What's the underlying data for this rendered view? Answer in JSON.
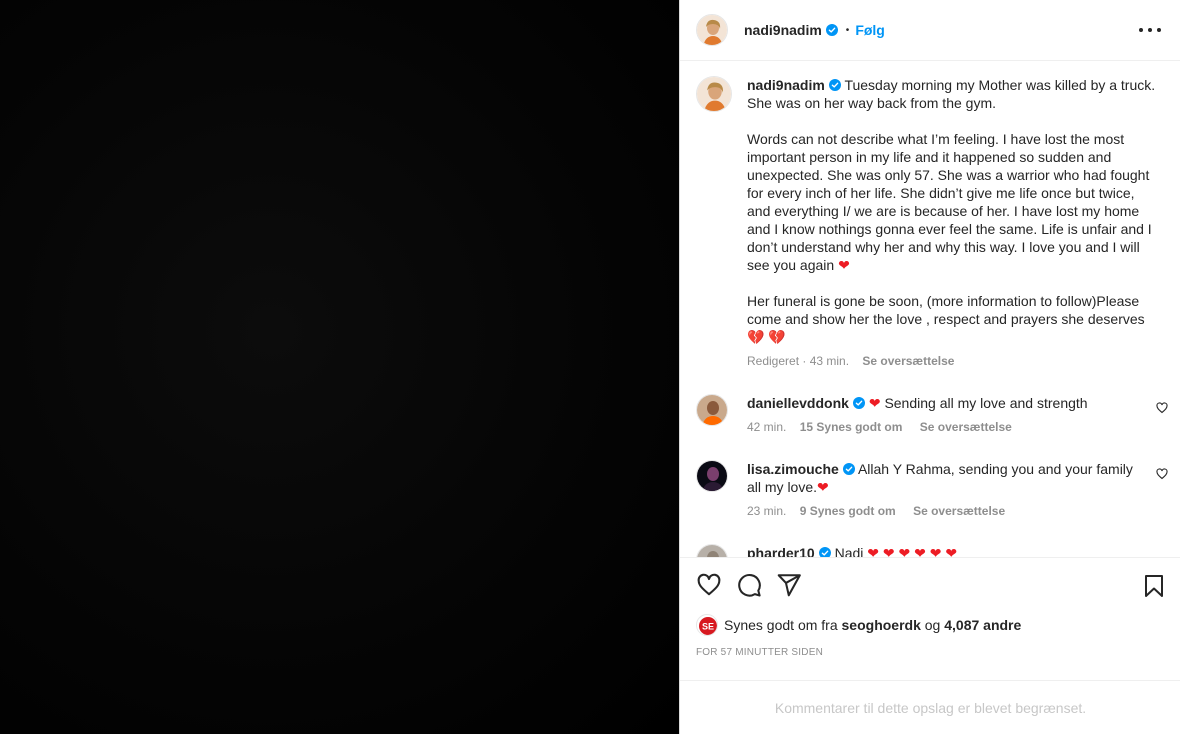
{
  "post": {
    "username": "nadi9nadim",
    "follow_label": "Følg",
    "separator": "•"
  },
  "caption": {
    "username": "nadi9nadim",
    "para1": "Tuesday morning my Mother was killed by a truck. She was on her way back from the gym.",
    "para2": "Words can not describe what I’m feeling. I have lost the most important person in my life and it happened so sudden and unexpected. She was only 57. She was a warrior who had fought for every inch of her life. She didn’t give me life once but twice, and everything I/ we are is because of her. I have lost my home and I know nothings gonna ever feel the same. Life is unfair and I don’t understand why her and why this way. I love you and I will see you again",
    "para2_emoji": "❤",
    "para3": "Her funeral is gone be soon, (more information to follow)Please come and show her the love , respect and prayers she deserves",
    "para3_emoji": "💔 💔",
    "edited": "Redigeret · 43 min.",
    "translate": "Se oversættelse"
  },
  "comments": [
    {
      "username": "daniellevddonk",
      "emoji_before": "❤",
      "text": "Sending all my love and strength",
      "time": "42 min.",
      "likes": "15 Synes godt om",
      "translate": "Se oversættelse"
    },
    {
      "username": "lisa.zimouche",
      "text": "Allah Y Rahma, sending you and your family all my love.",
      "emoji_after": "❤",
      "time": "23 min.",
      "likes": "9 Synes godt om",
      "translate": "Se oversættelse"
    },
    {
      "username": "pharder10",
      "text": "Nadi",
      "emoji_after": "❤ ❤ ❤ ❤ ❤ ❤"
    }
  ],
  "actions": {
    "liked_by_prefix": "Synes godt om fra",
    "liked_by_user": "seoghoerdk",
    "liked_by_and": "og",
    "liked_by_others": "4,087 andre",
    "timestamp": "For 57 minutter siden",
    "mini_avatar_text": "SE"
  },
  "footer": {
    "limited_comments": "Kommentarer til dette opslag er blevet begrænset."
  },
  "colors": {
    "link_blue": "#0095f6",
    "heart_red": "#ed1c24",
    "muted_gray": "#8e8e8e"
  }
}
